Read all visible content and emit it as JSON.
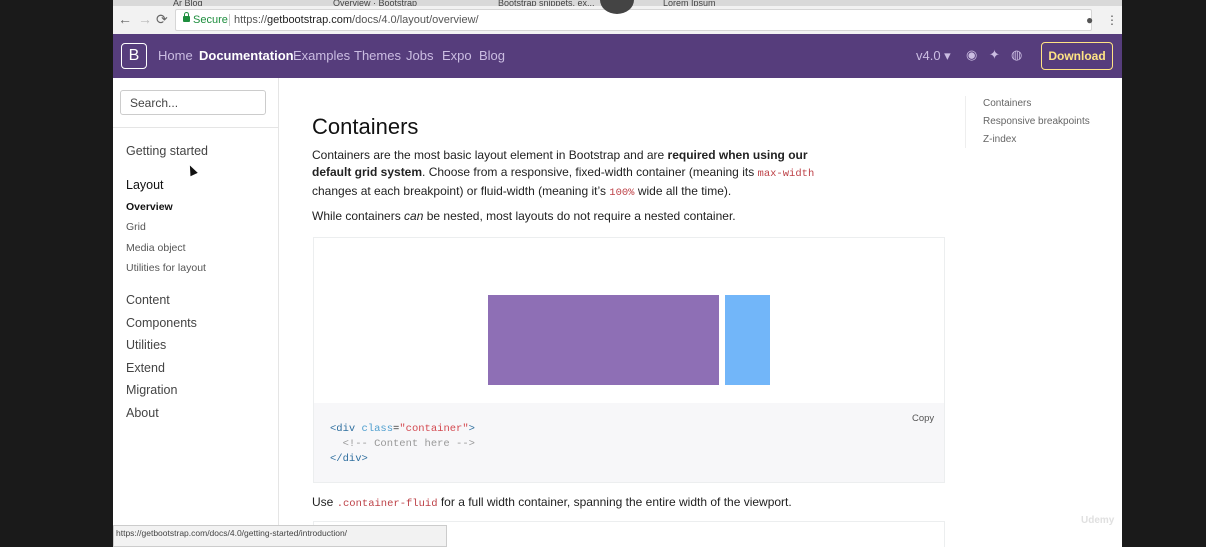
{
  "browser": {
    "tabs": [
      "Ar Blog",
      "Overview · Bootstrap",
      "Bootstrap snippets, ex...",
      "Lorem Ipsum"
    ],
    "back_icon": "←",
    "forward_icon": "→",
    "reload_icon": "⟳",
    "secure_label": "Secure",
    "url_prefix": "https://",
    "url_host": "getbootstrap.com",
    "url_path": "/docs/4.0/layout/overview/",
    "star_icon": "☆"
  },
  "navbar": {
    "brand": "B",
    "links": [
      "Home",
      "Documentation",
      "Examples",
      "Themes",
      "Jobs",
      "Expo",
      "Blog"
    ],
    "version": "v4.0 ▾",
    "download": "Download",
    "bg": "#563d7c",
    "download_color": "#ffe484"
  },
  "sidebar": {
    "search_placeholder": "Search...",
    "getting_started": "Getting started",
    "layout": "Layout",
    "layout_items": [
      "Overview",
      "Grid",
      "Media object",
      "Utilities for layout"
    ],
    "sections": [
      "Content",
      "Components",
      "Utilities",
      "Extend",
      "Migration",
      "About"
    ]
  },
  "main": {
    "title": "Containers",
    "p1_a": "Containers are the most basic layout element in Bootstrap and are ",
    "p1_b": "required when using our",
    "p1_c": "default grid system",
    "p1_d": ". Choose from a responsive, fixed-width container (meaning its ",
    "p1_code1": "max-width",
    "p1_e": "changes at each breakpoint) or fluid-width (meaning it’s ",
    "p1_code2": "100%",
    "p1_f": " wide all the time).",
    "p2_a": "While containers ",
    "p2_em": "can",
    "p2_b": " be nested, most layouts do not require a nested container.",
    "copy": "Copy",
    "code_line1_open": "<div ",
    "code_line1_attr": "class",
    "code_line1_eq": "=",
    "code_line1_val": "\"container\"",
    "code_line1_close": ">",
    "code_line2": "  <!-- Content here -->",
    "code_line3": "</div>",
    "p3_a": "Use ",
    "p3_code": ".container-fluid",
    "p3_b": " for a full width container, spanning the entire width of the viewport.",
    "box_colors": [
      "#8e6fb5",
      "#72b6f9"
    ]
  },
  "toc": [
    "Containers",
    "Responsive breakpoints",
    "Z-index"
  ],
  "status_url": "https://getbootstrap.com/docs/4.0/getting-started/introduction/",
  "watermark": "Udemy"
}
